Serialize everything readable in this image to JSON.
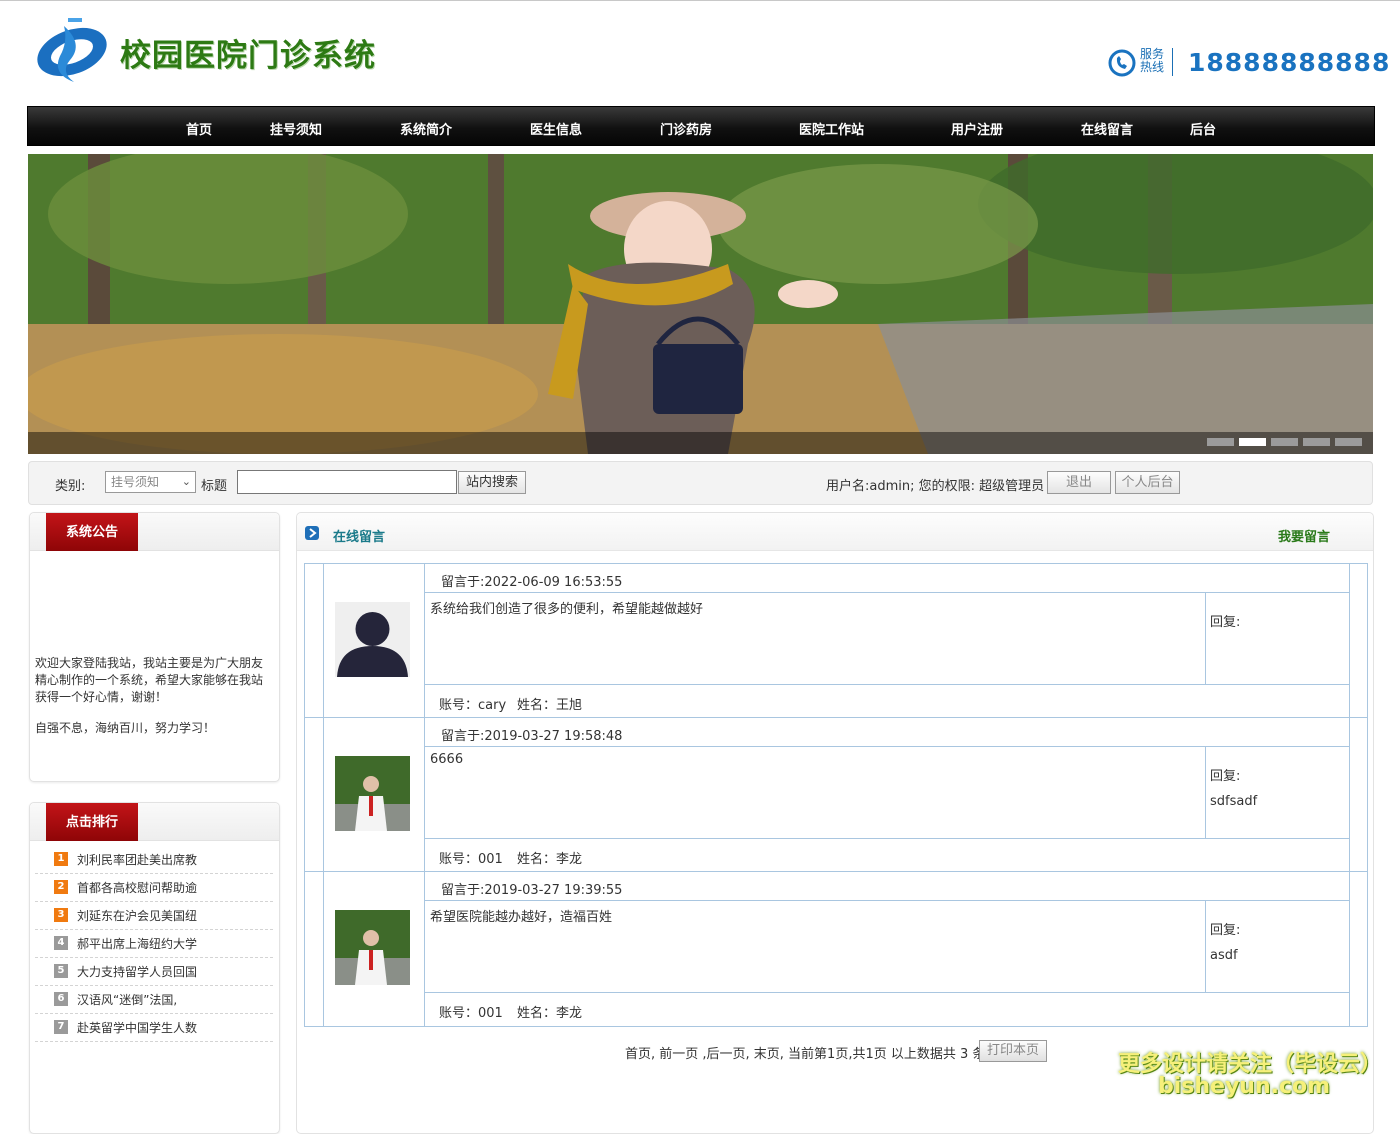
{
  "header": {
    "site_title": "校园医院门诊系统",
    "hotline_label": "服务热线",
    "hotline_number": "18888888888"
  },
  "nav": {
    "items": [
      {
        "label": "首页"
      },
      {
        "label": "挂号须知"
      },
      {
        "label": "系统简介"
      },
      {
        "label": "医生信息"
      },
      {
        "label": "门诊药房"
      },
      {
        "label": "医院工作站"
      },
      {
        "label": "用户注册"
      },
      {
        "label": "在线留言"
      },
      {
        "label": "后台"
      }
    ]
  },
  "banner": {
    "slide_count": 5,
    "active_slide": 2
  },
  "search": {
    "category_label": "类别:",
    "category_value": "挂号须知",
    "title_label": "标题",
    "title_value": "",
    "search_button": "站内搜索",
    "user_info": "用户名:admin;  您的权限: 超级管理员",
    "logout_button": "退出",
    "backend_button": "个人后台"
  },
  "notice": {
    "title": "系统公告",
    "text": "欢迎大家登陆我站，我站主要是为广大朋友精心制作的一个系统，希望大家能够在我站获得一个好心情，谢谢！",
    "motto": "自强不息，海纳百川，努力学习！"
  },
  "ranking": {
    "title": "点击排行",
    "items": [
      {
        "num": "1",
        "label": "刘利民率团赴美出席教",
        "color": "#f07a10"
      },
      {
        "num": "2",
        "label": "首都各高校慰问帮助逾",
        "color": "#f07a10"
      },
      {
        "num": "3",
        "label": "刘延东在沪会见美国纽",
        "color": "#f07a10"
      },
      {
        "num": "4",
        "label": "郝平出席上海纽约大学",
        "color": "#9a9a9a"
      },
      {
        "num": "5",
        "label": "大力支持留学人员回国",
        "color": "#9a9a9a"
      },
      {
        "num": "6",
        "label": "汉语风“迷倒”法国,",
        "color": "#9a9a9a"
      },
      {
        "num": "7",
        "label": "赴英留学中国学生人数",
        "color": "#9a9a9a"
      }
    ]
  },
  "messages_panel": {
    "title": "在线留言",
    "action": "我要留言"
  },
  "messages": [
    {
      "time": "留言于:2022-06-09 16:53:55",
      "content": "系统给我们创造了很多的便利，希望能越做越好",
      "reply_label": "回复:",
      "reply": "",
      "account": "账号：cary",
      "name": "姓名：王旭",
      "avatar": "default-avatar-icon"
    },
    {
      "time": "留言于:2019-03-27 19:58:48",
      "content": "6666",
      "reply_label": "回复:",
      "reply": "sdfsadf",
      "account": "账号：001",
      "name": "姓名：李龙",
      "avatar": "user-photo"
    },
    {
      "time": "留言于:2019-03-27 19:39:55",
      "content": "希望医院能越办越好，造福百姓",
      "reply_label": "回复:",
      "reply": "asdf",
      "account": "账号：001",
      "name": "姓名：李龙",
      "avatar": "user-photo"
    }
  ],
  "pager": {
    "text": "首页, 前一页 ,后一页, 末页, 当前第1页,共1页 以上数据共 3 条,",
    "print_button": "打印本页"
  },
  "watermark": {
    "line1": "更多设计请关注（毕设云）",
    "line2": "bisheyun.com"
  }
}
